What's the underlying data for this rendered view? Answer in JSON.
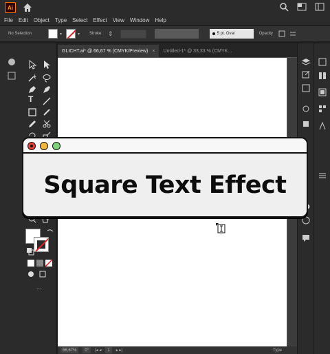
{
  "app": {
    "logo_text": "Ai"
  },
  "menu": [
    "File",
    "Edit",
    "Object",
    "Type",
    "Select",
    "Effect",
    "View",
    "Window",
    "Help"
  ],
  "control_bar": {
    "selection_label": "No Selection",
    "stroke_label": "Stroke:",
    "brush_label": "5 pt. Oval",
    "opacity_label": "Opacity"
  },
  "tabs": [
    {
      "label": "GLICHT.ai* @ 66,67 % (CMYK/Preview)",
      "active": true
    },
    {
      "label": "Untitled-1* @ 33,33 % (CMYK..."
    }
  ],
  "status_bar": {
    "zoom": "66,67%",
    "rotation": "0°",
    "artboard_number": "1",
    "mode": "Type"
  },
  "tools_panel": {
    "type_tool_glyph": "T",
    "more_tools": "..."
  },
  "card": {
    "title": "Square Text Effect"
  },
  "colors": {
    "ui_dark": "#2b2b2b",
    "canvas_gray": "#535353",
    "close_red": "#e5423a",
    "minimize_yellow": "#f1b83a",
    "maximize_green": "#7fd07a",
    "stroke_none_red": "#e02020"
  }
}
